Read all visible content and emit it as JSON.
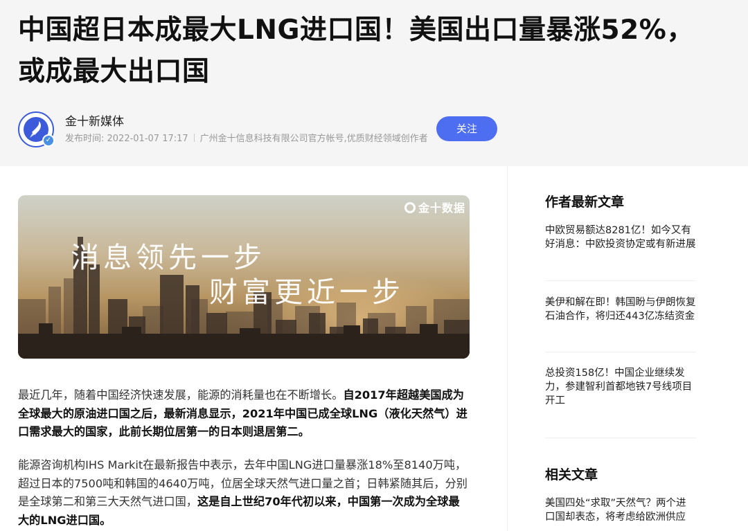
{
  "article": {
    "title": "中国超日本成最大LNG进口国！美国出口量暴涨52%，或成最大出口国",
    "author": {
      "name": "金十新媒体",
      "publish_label": "发布时间: 2022-01-07 17:17",
      "description": "广州金十信息科技有限公司官方帐号,优质财经领域创作者"
    },
    "follow_label": "关注",
    "banner": {
      "logo": "金十数据",
      "slogan_line1": "消息领先一步",
      "slogan_line2": "财富更近一步"
    },
    "paragraphs": [
      {
        "normal": "最近几年，随着中国经济快速发展，能源的消耗量也在不断增长。",
        "bold": "自2017年超越美国成为全球最大的原油进口国之后，最新消息显示，2021年中国已成全球LNG（液化天然气）进口需求最大的国家，此前长期位居第一的日本则退居第二。"
      },
      {
        "normal": "能源咨询机构IHS Markit在最新报告中表示，去年中国LNG进口量暴涨18%至8140万吨，超过日本的7500吨和韩国的4640万吨，位居全球天然气进口量之首；日韩紧随其后，分别是全球第二和第三大天然气进口国，",
        "bold": "这是自上世纪70年代初以来，中国第一次成为全球最大的LNG进口国。"
      }
    ]
  },
  "sidebar": {
    "latest_heading": "作者最新文章",
    "latest": [
      "中欧贸易额达8281亿！如今又有好消息：中欧投资协定或有新进展",
      "美伊和解在即！韩国盼与伊朗恢复石油合作，将归还443亿冻结资金",
      "总投资158亿！中国企业继续发力，参建智利首都地铁7号线项目开工"
    ],
    "related_heading": "相关文章",
    "related": [
      "美国四处“求取”天然气？两个进口国却表态，将考虑给欧洲供应"
    ]
  },
  "icons": {
    "avatar": "rocket-icon",
    "verified": "verified-badge-icon"
  },
  "colors": {
    "accent": "#4e6ef2",
    "header_bg": "#f5f5f5"
  }
}
